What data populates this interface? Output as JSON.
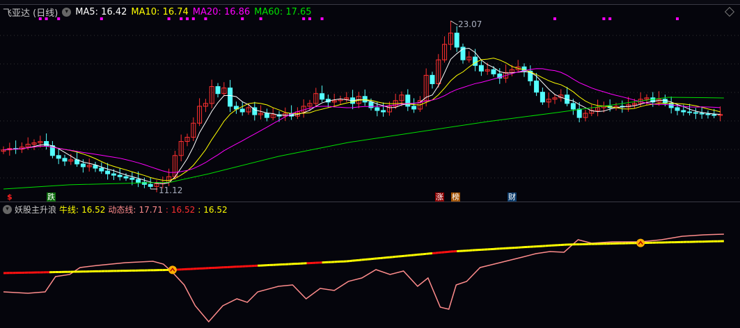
{
  "header": {
    "stock": "飞亚达 (日线)",
    "ma5": "MA5: 16.42",
    "ma10": "MA10: 16.74",
    "ma20": "MA20: 16.86",
    "ma60": "MA60: 17.65"
  },
  "indicator": {
    "name": "妖股主升浪",
    "bull_label": "牛线:",
    "bull_value": "16.52",
    "dyn_label": "动态线:",
    "dyn_value": "17.71",
    "sep1": ":",
    "v2": "16.52",
    "sep2": ":",
    "v3": "16.52"
  },
  "annotations": {
    "high": "23.07",
    "low": "11.12"
  },
  "signals": {
    "s1": "$",
    "s2": "跌",
    "s3": "涨",
    "s4": "榜",
    "s5": "财"
  },
  "colors": {
    "up": "#ff3030",
    "down": "#54ffff",
    "ma5": "#ffffff",
    "ma10": "#ffff00",
    "ma20": "#ff00ff",
    "ma60": "#00e000",
    "bull": "#ffff00",
    "bull_alt": "#ff1010",
    "dyn": "#ff8c8c"
  },
  "chart_data": {
    "type": "candlestick",
    "closes": [
      13.9,
      14.0,
      13.95,
      14.1,
      14.3,
      14.4,
      14.5,
      14.2,
      13.5,
      13.3,
      13.1,
      13.2,
      12.9,
      12.7,
      12.8,
      12.6,
      12.4,
      12.2,
      12.1,
      12.0,
      11.9,
      11.8,
      11.6,
      11.45,
      11.3,
      11.5,
      11.6,
      12.0,
      13.5,
      14.5,
      14.8,
      15.8,
      17.0,
      17.2,
      18.4,
      17.9,
      18.3,
      17.0,
      16.8,
      16.6,
      16.9,
      16.4,
      16.5,
      16.2,
      16.4,
      16.3,
      16.5,
      16.3,
      16.6,
      17.0,
      17.2,
      17.9,
      17.5,
      17.3,
      17.4,
      17.5,
      17.6,
      17.2,
      17.7,
      17.3,
      16.9,
      16.7,
      16.6,
      17.0,
      17.4,
      17.8,
      17.0,
      16.8,
      17.4,
      19.2,
      18.6,
      20.3,
      21.4,
      22.2,
      21.2,
      20.3,
      20.5,
      19.9,
      19.5,
      19.6,
      19.3,
      19.0,
      19.4,
      19.6,
      19.8,
      19.5,
      18.8,
      18.0,
      17.3,
      17.5,
      17.6,
      17.8,
      17.2,
      16.8,
      16.2,
      16.5,
      16.7,
      16.9,
      17.0,
      16.9,
      17.0,
      16.95,
      17.1,
      17.2,
      17.5,
      17.6,
      17.3,
      17.5,
      17.2,
      16.9,
      16.7,
      16.6,
      16.55,
      16.5,
      16.45,
      16.4,
      16.35,
      16.42
    ],
    "high_point": {
      "index": 73,
      "price": 23.07
    },
    "low_point": {
      "index": 24,
      "price": 11.12
    },
    "ma60": [
      [
        0,
        11.12
      ],
      [
        10.8,
        11.42
      ],
      [
        27.3,
        11.61
      ],
      [
        33.5,
        12.2
      ],
      [
        44.9,
        13.44
      ],
      [
        56.3,
        14.43
      ],
      [
        67.6,
        15.17
      ],
      [
        79,
        15.91
      ],
      [
        90.3,
        16.55
      ],
      [
        101.7,
        17.24
      ],
      [
        108.5,
        17.64
      ],
      [
        117.6,
        17.59
      ]
    ],
    "signal_dots": [
      6,
      7,
      9,
      16,
      27,
      29,
      30,
      31,
      33,
      39,
      42,
      49,
      50,
      52,
      90,
      98,
      99,
      110
    ],
    "bull_line": [
      [
        0,
        11.05
      ],
      [
        27.6,
        11.6
      ],
      [
        56,
        13.07
      ],
      [
        73,
        14.73
      ],
      [
        92,
        15.93
      ],
      [
        117.6,
        16.52
      ]
    ],
    "bull_red_ranges": [
      [
        0,
        7.4
      ],
      [
        27.6,
        41.5
      ],
      [
        49.4,
        51.7
      ],
      [
        70,
        73.9
      ]
    ],
    "dynamic_line": [
      [
        0,
        7.83
      ],
      [
        4,
        7.59
      ],
      [
        6.8,
        7.83
      ],
      [
        8.5,
        10.45
      ],
      [
        10.8,
        10.81
      ],
      [
        12.5,
        12.0
      ],
      [
        15.3,
        12.35
      ],
      [
        19.9,
        12.83
      ],
      [
        24.4,
        13.07
      ],
      [
        26.1,
        12.59
      ],
      [
        27.6,
        11.16
      ],
      [
        29.5,
        9.02
      ],
      [
        31.3,
        5.45
      ],
      [
        33.5,
        2.71
      ],
      [
        35.8,
        5.45
      ],
      [
        38.1,
        6.64
      ],
      [
        39.8,
        6.04
      ],
      [
        41.5,
        7.83
      ],
      [
        44.9,
        8.78
      ],
      [
        47.2,
        9.02
      ],
      [
        49.4,
        6.64
      ],
      [
        51.7,
        8.42
      ],
      [
        54,
        8.07
      ],
      [
        56.3,
        9.62
      ],
      [
        58.5,
        10.21
      ],
      [
        60.8,
        11.64
      ],
      [
        63.1,
        10.81
      ],
      [
        65.3,
        11.4
      ],
      [
        67.6,
        8.78
      ],
      [
        69.3,
        10.21
      ],
      [
        71.3,
        5.21
      ],
      [
        72.7,
        4.85
      ],
      [
        73.9,
        9.02
      ],
      [
        75.6,
        9.62
      ],
      [
        77.8,
        12.0
      ],
      [
        80.1,
        12.59
      ],
      [
        82.4,
        13.19
      ],
      [
        84.7,
        13.78
      ],
      [
        86.9,
        14.38
      ],
      [
        89.2,
        14.73
      ],
      [
        91.5,
        14.62
      ],
      [
        93.8,
        16.76
      ],
      [
        96,
        16.16
      ],
      [
        99.4,
        16.4
      ],
      [
        104,
        16.4
      ],
      [
        107.4,
        16.76
      ],
      [
        110.8,
        17.35
      ],
      [
        114.2,
        17.59
      ],
      [
        117.6,
        17.71
      ]
    ],
    "cross_markers": [
      27.6,
      104
    ]
  }
}
